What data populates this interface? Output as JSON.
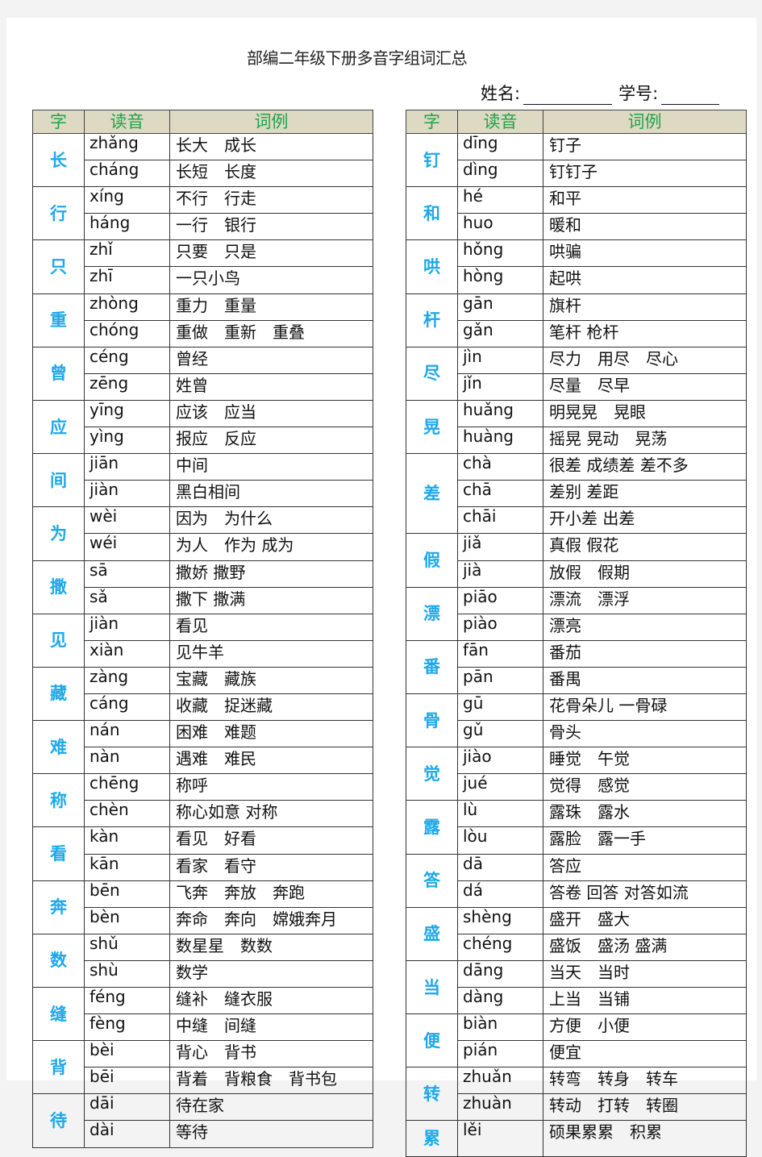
{
  "document": {
    "title": "部编二年级下册多音字组词汇总",
    "name_label": "姓名:",
    "number_label": "学号:"
  },
  "table_headers": {
    "char": "字",
    "reading": "读音",
    "examples": "词例"
  },
  "colors": {
    "header_bg": "#ddd9c3",
    "header_text": "#1aa64a",
    "char_text": "#1ea8e8"
  },
  "left_table": [
    {
      "char": "长",
      "readings": [
        {
          "pinyin": "zhǎng",
          "examples": "长大　成长"
        },
        {
          "pinyin": "cháng",
          "examples": "长短　长度"
        }
      ]
    },
    {
      "char": "行",
      "readings": [
        {
          "pinyin": "xíng",
          "examples": "不行　行走"
        },
        {
          "pinyin": "háng",
          "examples": "一行　银行"
        }
      ]
    },
    {
      "char": "只",
      "readings": [
        {
          "pinyin": "zhǐ",
          "examples": "只要　只是"
        },
        {
          "pinyin": "zhī",
          "examples": "一只小鸟"
        }
      ]
    },
    {
      "char": "重",
      "readings": [
        {
          "pinyin": "zhòng",
          "examples": "重力　重量"
        },
        {
          "pinyin": "chóng",
          "examples": "重做　重新　重叠"
        }
      ]
    },
    {
      "char": "曾",
      "readings": [
        {
          "pinyin": "céng",
          "examples": "曾经"
        },
        {
          "pinyin": "zēng",
          "examples": "姓曾"
        }
      ]
    },
    {
      "char": "应",
      "readings": [
        {
          "pinyin": "yīng",
          "examples": "应该　应当"
        },
        {
          "pinyin": "yìng",
          "examples": "报应　反应"
        }
      ]
    },
    {
      "char": "间",
      "readings": [
        {
          "pinyin": "jiān",
          "examples": "中间"
        },
        {
          "pinyin": "jiàn",
          "examples": "黑白相间"
        }
      ]
    },
    {
      "char": "为",
      "readings": [
        {
          "pinyin": "wèi",
          "examples": "因为　为什么"
        },
        {
          "pinyin": "wéi",
          "examples": "为人　作为 成为"
        }
      ]
    },
    {
      "char": "撒",
      "readings": [
        {
          "pinyin": "sā",
          "examples": "撒娇 撒野"
        },
        {
          "pinyin": "sǎ",
          "examples": "撒下 撒满"
        }
      ]
    },
    {
      "char": "见",
      "readings": [
        {
          "pinyin": "jiàn",
          "examples": "看见"
        },
        {
          "pinyin": "xiàn",
          "examples": "见牛羊"
        }
      ]
    },
    {
      "char": "藏",
      "readings": [
        {
          "pinyin": "zàng",
          "examples": "宝藏　藏族"
        },
        {
          "pinyin": "cáng",
          "examples": "收藏　捉迷藏"
        }
      ]
    },
    {
      "char": "难",
      "readings": [
        {
          "pinyin": "nán",
          "examples": "困难　难题"
        },
        {
          "pinyin": "nàn",
          "examples": "遇难　难民"
        }
      ]
    },
    {
      "char": "称",
      "readings": [
        {
          "pinyin": "chēng",
          "examples": "称呼"
        },
        {
          "pinyin": "chèn",
          "examples": "称心如意 对称"
        }
      ]
    },
    {
      "char": "看",
      "readings": [
        {
          "pinyin": "kàn",
          "examples": "看见　好看"
        },
        {
          "pinyin": "kān",
          "examples": "看家　看守"
        }
      ]
    },
    {
      "char": "奔",
      "readings": [
        {
          "pinyin": "bēn",
          "examples": "飞奔　奔放　奔跑"
        },
        {
          "pinyin": "bèn",
          "examples": "奔命　奔向　嫦娥奔月"
        }
      ]
    },
    {
      "char": "数",
      "readings": [
        {
          "pinyin": "shǔ",
          "examples": "数星星　数数"
        },
        {
          "pinyin": "shù",
          "examples": "数学"
        }
      ]
    },
    {
      "char": "缝",
      "readings": [
        {
          "pinyin": "féng",
          "examples": "缝补　缝衣服"
        },
        {
          "pinyin": "fèng",
          "examples": "中缝　间缝"
        }
      ]
    },
    {
      "char": "背",
      "readings": [
        {
          "pinyin": "bèi",
          "examples": "背心　背书"
        },
        {
          "pinyin": "bēi",
          "examples": "背着　背粮食　背书包"
        }
      ]
    },
    {
      "char": "待",
      "readings": [
        {
          "pinyin": "dāi",
          "examples": "待在家"
        },
        {
          "pinyin": "dài",
          "examples": "等待"
        }
      ]
    }
  ],
  "right_table": [
    {
      "char": "钉",
      "readings": [
        {
          "pinyin": "dīng",
          "examples": "钉子"
        },
        {
          "pinyin": "dìng",
          "examples": "钉钉子"
        }
      ]
    },
    {
      "char": "和",
      "readings": [
        {
          "pinyin": "hé",
          "examples": "和平"
        },
        {
          "pinyin": "huo",
          "examples": "暖和"
        }
      ]
    },
    {
      "char": "哄",
      "readings": [
        {
          "pinyin": "hǒng",
          "examples": "哄骗"
        },
        {
          "pinyin": "hòng",
          "examples": "起哄"
        }
      ]
    },
    {
      "char": "杆",
      "readings": [
        {
          "pinyin": "gān",
          "examples": "旗杆"
        },
        {
          "pinyin": "gǎn",
          "examples": "笔杆 枪杆"
        }
      ]
    },
    {
      "char": "尽",
      "readings": [
        {
          "pinyin": "jìn",
          "examples": "尽力　用尽　尽心"
        },
        {
          "pinyin": "jǐn",
          "examples": "尽量　尽早"
        }
      ]
    },
    {
      "char": "晃",
      "readings": [
        {
          "pinyin": "huǎng",
          "examples": "明晃晃　晃眼"
        },
        {
          "pinyin": "huàng",
          "examples": "摇晃 晃动　晃荡"
        }
      ]
    },
    {
      "char": "差",
      "readings": [
        {
          "pinyin": "chà",
          "examples": "很差 成绩差 差不多"
        },
        {
          "pinyin": "chā",
          "examples": "差别 差距"
        },
        {
          "pinyin": "chāi",
          "examples": "开小差 出差"
        }
      ]
    },
    {
      "char": "假",
      "readings": [
        {
          "pinyin": "jiǎ",
          "examples": "真假 假花"
        },
        {
          "pinyin": "jià",
          "examples": "放假　假期"
        }
      ]
    },
    {
      "char": "漂",
      "readings": [
        {
          "pinyin": "piāo",
          "examples": "漂流　漂浮"
        },
        {
          "pinyin": "piào",
          "examples": "漂亮"
        }
      ]
    },
    {
      "char": "番",
      "readings": [
        {
          "pinyin": "fān",
          "examples": "番茄"
        },
        {
          "pinyin": "pān",
          "examples": "番禺"
        }
      ]
    },
    {
      "char": "骨",
      "readings": [
        {
          "pinyin": "gū",
          "examples": "花骨朵儿 一骨碌"
        },
        {
          "pinyin": "gǔ",
          "examples": "骨头"
        }
      ]
    },
    {
      "char": "觉",
      "readings": [
        {
          "pinyin": "jiào",
          "examples": "睡觉　午觉"
        },
        {
          "pinyin": "jué",
          "examples": "觉得　感觉"
        }
      ]
    },
    {
      "char": "露",
      "readings": [
        {
          "pinyin": "lù",
          "examples": "露珠　露水"
        },
        {
          "pinyin": "lòu",
          "examples": "露脸　露一手"
        }
      ]
    },
    {
      "char": "答",
      "readings": [
        {
          "pinyin": "dā",
          "examples": "答应"
        },
        {
          "pinyin": "dá",
          "examples": "答卷 回答 对答如流"
        }
      ]
    },
    {
      "char": "盛",
      "readings": [
        {
          "pinyin": "shèng",
          "examples": "盛开　盛大"
        },
        {
          "pinyin": "chéng",
          "examples": "盛饭　盛汤 盛满"
        }
      ]
    },
    {
      "char": "当",
      "readings": [
        {
          "pinyin": "dāng",
          "examples": "当天　当时"
        },
        {
          "pinyin": "dàng",
          "examples": "上当　当铺"
        }
      ]
    },
    {
      "char": "便",
      "readings": [
        {
          "pinyin": "biàn",
          "examples": "方便　小便"
        },
        {
          "pinyin": "pián",
          "examples": "便宜"
        }
      ]
    },
    {
      "char": "转",
      "readings": [
        {
          "pinyin": "zhuǎn",
          "examples": "转弯　转身　转车"
        },
        {
          "pinyin": "zhuàn",
          "examples": "转动　打转　转圈"
        }
      ]
    },
    {
      "char": "累",
      "readings": [
        {
          "pinyin": "lěi",
          "examples": "硕果累累　积累"
        }
      ]
    }
  ]
}
